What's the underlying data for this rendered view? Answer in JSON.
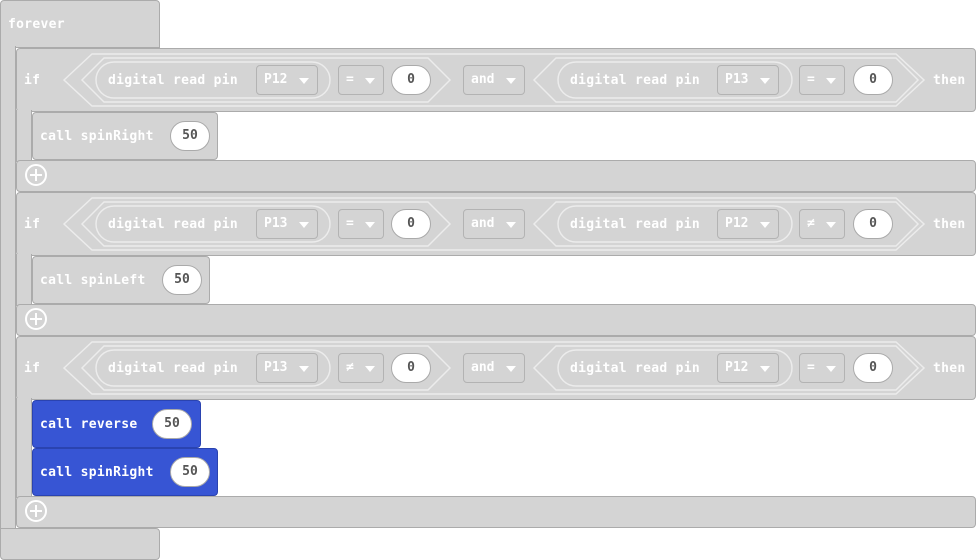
{
  "forever_label": "forever",
  "if_blocks": [
    {
      "if_label": "if",
      "then_label": "then",
      "and_label": "and",
      "left": {
        "label": "digital read pin",
        "pin": "P12",
        "op": "=",
        "value": "0"
      },
      "right": {
        "label": "digital read pin",
        "pin": "P13",
        "op": "=",
        "value": "0"
      },
      "calls": [
        {
          "label": "call spinRight",
          "value": "50"
        }
      ]
    },
    {
      "if_label": "if",
      "then_label": "then",
      "and_label": "and",
      "left": {
        "label": "digital read pin",
        "pin": "P13",
        "op": "=",
        "value": "0"
      },
      "right": {
        "label": "digital read pin",
        "pin": "P12",
        "op": "≠",
        "value": "0"
      },
      "calls": [
        {
          "label": "call spinLeft",
          "value": "50"
        }
      ]
    },
    {
      "if_label": "if",
      "then_label": "then",
      "and_label": "and",
      "left": {
        "label": "digital read pin",
        "pin": "P13",
        "op": "≠",
        "value": "0"
      },
      "right": {
        "label": "digital read pin",
        "pin": "P12",
        "op": "=",
        "value": "0"
      },
      "calls": [
        {
          "label": "call reverse",
          "value": "50"
        },
        {
          "label": "call spinRight",
          "value": "50"
        }
      ]
    }
  ],
  "colors": {
    "disabled_block": "#d4d4d4",
    "disabled_border": "#ababab",
    "function_call_block": "#3755d4",
    "text": "#ffffff",
    "value_text": "#555555"
  },
  "icons": [
    "add-else-plus-icon",
    "dropdown-caret-icon"
  ]
}
